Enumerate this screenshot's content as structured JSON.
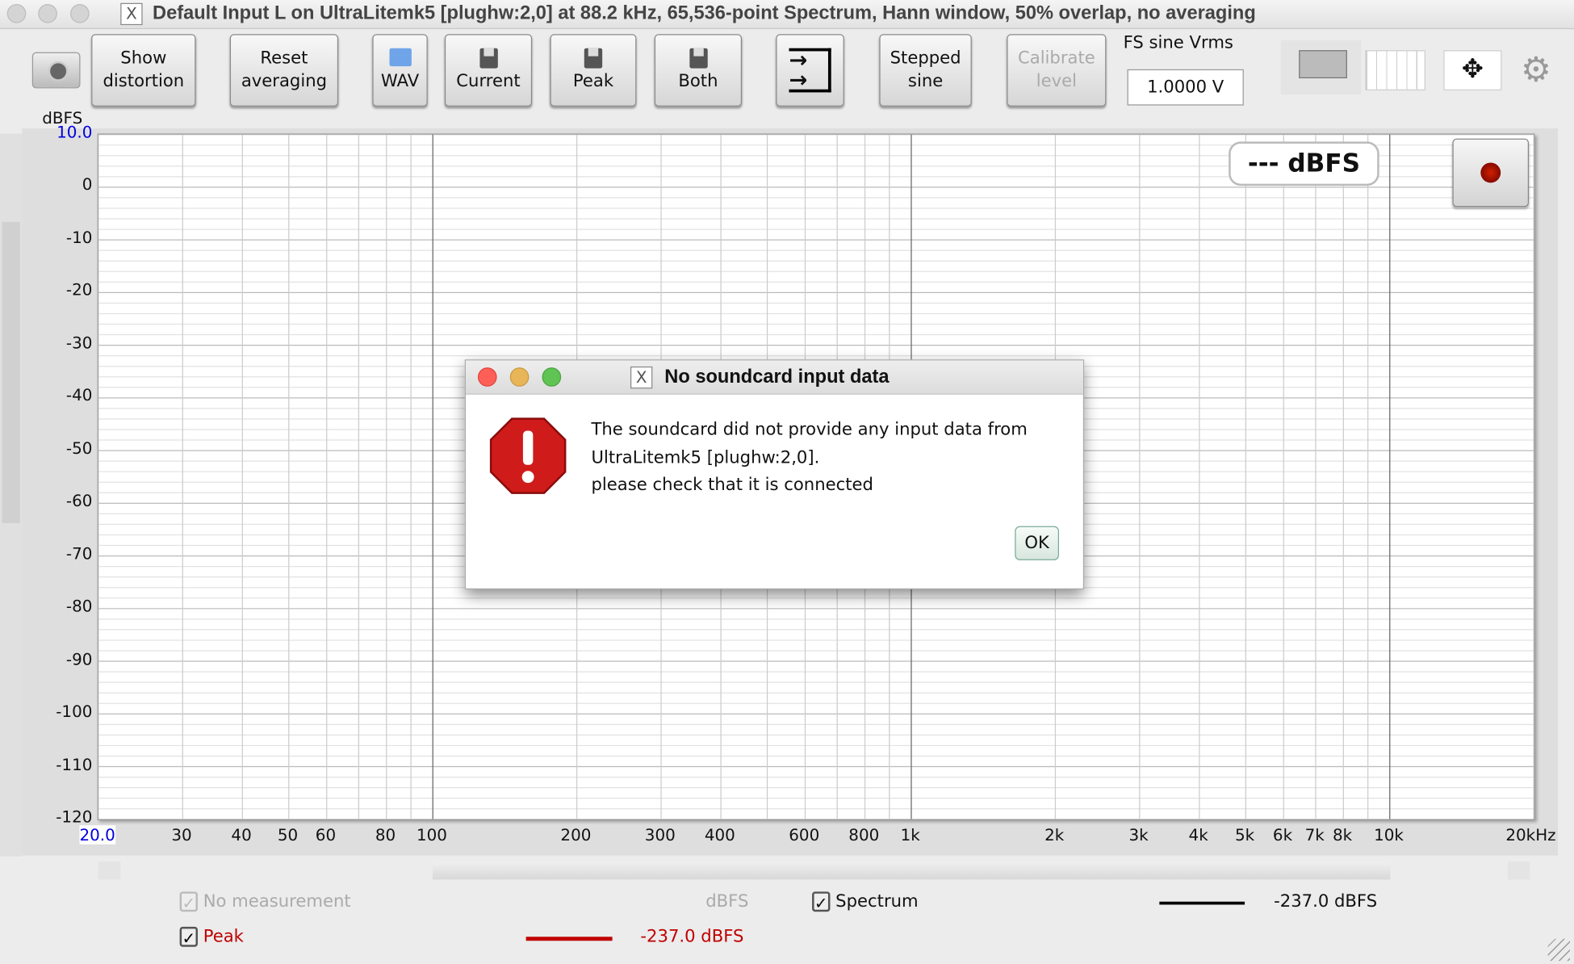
{
  "window": {
    "title": "Default Input L on UltraLitemk5 [plughw:2,0] at 88.2 kHz, 65,536-point Spectrum, Hann window, 50% overlap, no averaging"
  },
  "toolbar": {
    "show_distortion": [
      "Show",
      "distortion"
    ],
    "reset_averaging": [
      "Reset",
      "averaging"
    ],
    "wav": "WAV",
    "current": "Current",
    "peak": "Peak",
    "both": "Both",
    "stepped_sine": [
      "Stepped",
      "sine"
    ],
    "calibrate_level": [
      "Calibrate",
      "level"
    ],
    "fs_label": "FS sine Vrms",
    "fs_value": "1.0000 V"
  },
  "plot": {
    "y_unit": "dBFS",
    "y_ticks": [
      "10.0",
      "0",
      "-10",
      "-20",
      "-30",
      "-40",
      "-50",
      "-60",
      "-70",
      "-80",
      "-90",
      "-100",
      "-110",
      "-120"
    ],
    "x_ticks": [
      {
        "f": 20,
        "l": "20.0"
      },
      {
        "f": 30,
        "l": "30"
      },
      {
        "f": 40,
        "l": "40"
      },
      {
        "f": 50,
        "l": "50"
      },
      {
        "f": 60,
        "l": "60"
      },
      {
        "f": 80,
        "l": "80"
      },
      {
        "f": 100,
        "l": "100"
      },
      {
        "f": 200,
        "l": "200"
      },
      {
        "f": 300,
        "l": "300"
      },
      {
        "f": 400,
        "l": "400"
      },
      {
        "f": 600,
        "l": "600"
      },
      {
        "f": 800,
        "l": "800"
      },
      {
        "f": 1000,
        "l": "1k"
      },
      {
        "f": 2000,
        "l": "2k"
      },
      {
        "f": 3000,
        "l": "3k"
      },
      {
        "f": 4000,
        "l": "4k"
      },
      {
        "f": 5000,
        "l": "5k"
      },
      {
        "f": 6000,
        "l": "6k"
      },
      {
        "f": 7000,
        "l": "7k"
      },
      {
        "f": 8000,
        "l": "8k"
      },
      {
        "f": 10000,
        "l": "10k"
      },
      {
        "f": 20000,
        "l": "20kHz"
      }
    ],
    "y_range": [
      -120,
      10
    ],
    "x_range": [
      20,
      20000
    ],
    "x_scale": "log",
    "readout": "--- dBFS"
  },
  "dialog": {
    "title": "No soundcard input data",
    "lines": [
      "The soundcard did not provide any input data from",
      "UltraLitemk5 [plughw:2,0].",
      "please check that it is connected"
    ],
    "ok": "OK"
  },
  "legend": {
    "no_measurement": "No measurement",
    "no_measurement_unit": "dBFS",
    "spectrum": "Spectrum",
    "spectrum_value": "-237.0 dBFS",
    "peak": "Peak",
    "peak_value": "-237.0 dBFS",
    "check": "✓",
    "peak_color": "#c00000",
    "spectrum_color": "#000000"
  }
}
